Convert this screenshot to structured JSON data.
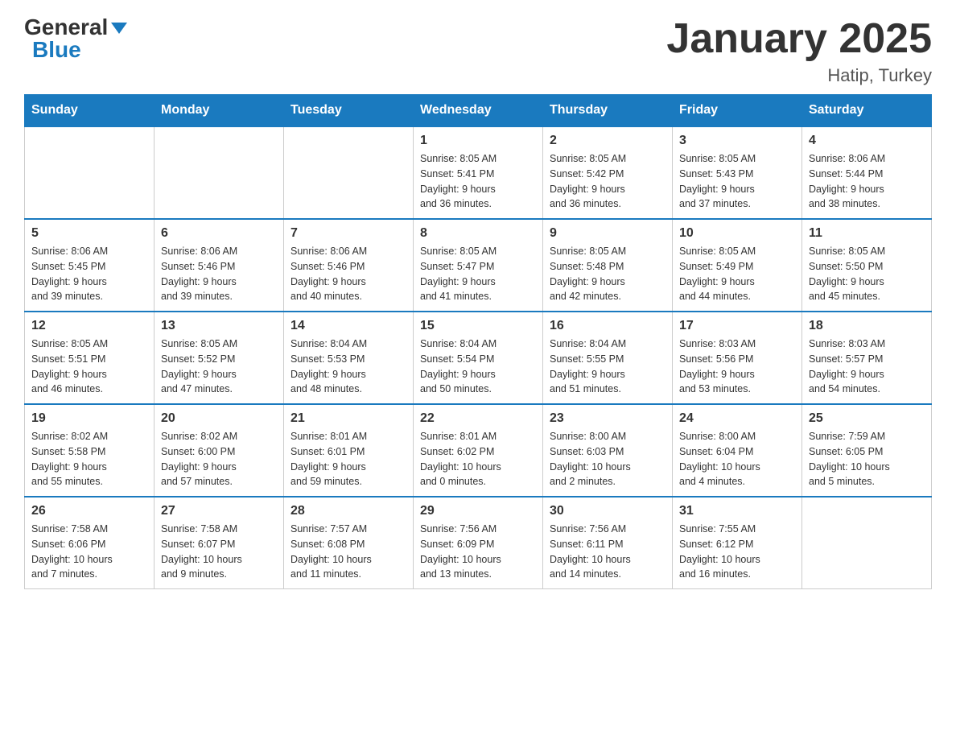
{
  "header": {
    "logo_general": "General",
    "logo_blue": "Blue",
    "month_title": "January 2025",
    "location": "Hatip, Turkey"
  },
  "weekdays": [
    "Sunday",
    "Monday",
    "Tuesday",
    "Wednesday",
    "Thursday",
    "Friday",
    "Saturday"
  ],
  "weeks": [
    [
      {
        "day": "",
        "info": ""
      },
      {
        "day": "",
        "info": ""
      },
      {
        "day": "",
        "info": ""
      },
      {
        "day": "1",
        "info": "Sunrise: 8:05 AM\nSunset: 5:41 PM\nDaylight: 9 hours\nand 36 minutes."
      },
      {
        "day": "2",
        "info": "Sunrise: 8:05 AM\nSunset: 5:42 PM\nDaylight: 9 hours\nand 36 minutes."
      },
      {
        "day": "3",
        "info": "Sunrise: 8:05 AM\nSunset: 5:43 PM\nDaylight: 9 hours\nand 37 minutes."
      },
      {
        "day": "4",
        "info": "Sunrise: 8:06 AM\nSunset: 5:44 PM\nDaylight: 9 hours\nand 38 minutes."
      }
    ],
    [
      {
        "day": "5",
        "info": "Sunrise: 8:06 AM\nSunset: 5:45 PM\nDaylight: 9 hours\nand 39 minutes."
      },
      {
        "day": "6",
        "info": "Sunrise: 8:06 AM\nSunset: 5:46 PM\nDaylight: 9 hours\nand 39 minutes."
      },
      {
        "day": "7",
        "info": "Sunrise: 8:06 AM\nSunset: 5:46 PM\nDaylight: 9 hours\nand 40 minutes."
      },
      {
        "day": "8",
        "info": "Sunrise: 8:05 AM\nSunset: 5:47 PM\nDaylight: 9 hours\nand 41 minutes."
      },
      {
        "day": "9",
        "info": "Sunrise: 8:05 AM\nSunset: 5:48 PM\nDaylight: 9 hours\nand 42 minutes."
      },
      {
        "day": "10",
        "info": "Sunrise: 8:05 AM\nSunset: 5:49 PM\nDaylight: 9 hours\nand 44 minutes."
      },
      {
        "day": "11",
        "info": "Sunrise: 8:05 AM\nSunset: 5:50 PM\nDaylight: 9 hours\nand 45 minutes."
      }
    ],
    [
      {
        "day": "12",
        "info": "Sunrise: 8:05 AM\nSunset: 5:51 PM\nDaylight: 9 hours\nand 46 minutes."
      },
      {
        "day": "13",
        "info": "Sunrise: 8:05 AM\nSunset: 5:52 PM\nDaylight: 9 hours\nand 47 minutes."
      },
      {
        "day": "14",
        "info": "Sunrise: 8:04 AM\nSunset: 5:53 PM\nDaylight: 9 hours\nand 48 minutes."
      },
      {
        "day": "15",
        "info": "Sunrise: 8:04 AM\nSunset: 5:54 PM\nDaylight: 9 hours\nand 50 minutes."
      },
      {
        "day": "16",
        "info": "Sunrise: 8:04 AM\nSunset: 5:55 PM\nDaylight: 9 hours\nand 51 minutes."
      },
      {
        "day": "17",
        "info": "Sunrise: 8:03 AM\nSunset: 5:56 PM\nDaylight: 9 hours\nand 53 minutes."
      },
      {
        "day": "18",
        "info": "Sunrise: 8:03 AM\nSunset: 5:57 PM\nDaylight: 9 hours\nand 54 minutes."
      }
    ],
    [
      {
        "day": "19",
        "info": "Sunrise: 8:02 AM\nSunset: 5:58 PM\nDaylight: 9 hours\nand 55 minutes."
      },
      {
        "day": "20",
        "info": "Sunrise: 8:02 AM\nSunset: 6:00 PM\nDaylight: 9 hours\nand 57 minutes."
      },
      {
        "day": "21",
        "info": "Sunrise: 8:01 AM\nSunset: 6:01 PM\nDaylight: 9 hours\nand 59 minutes."
      },
      {
        "day": "22",
        "info": "Sunrise: 8:01 AM\nSunset: 6:02 PM\nDaylight: 10 hours\nand 0 minutes."
      },
      {
        "day": "23",
        "info": "Sunrise: 8:00 AM\nSunset: 6:03 PM\nDaylight: 10 hours\nand 2 minutes."
      },
      {
        "day": "24",
        "info": "Sunrise: 8:00 AM\nSunset: 6:04 PM\nDaylight: 10 hours\nand 4 minutes."
      },
      {
        "day": "25",
        "info": "Sunrise: 7:59 AM\nSunset: 6:05 PM\nDaylight: 10 hours\nand 5 minutes."
      }
    ],
    [
      {
        "day": "26",
        "info": "Sunrise: 7:58 AM\nSunset: 6:06 PM\nDaylight: 10 hours\nand 7 minutes."
      },
      {
        "day": "27",
        "info": "Sunrise: 7:58 AM\nSunset: 6:07 PM\nDaylight: 10 hours\nand 9 minutes."
      },
      {
        "day": "28",
        "info": "Sunrise: 7:57 AM\nSunset: 6:08 PM\nDaylight: 10 hours\nand 11 minutes."
      },
      {
        "day": "29",
        "info": "Sunrise: 7:56 AM\nSunset: 6:09 PM\nDaylight: 10 hours\nand 13 minutes."
      },
      {
        "day": "30",
        "info": "Sunrise: 7:56 AM\nSunset: 6:11 PM\nDaylight: 10 hours\nand 14 minutes."
      },
      {
        "day": "31",
        "info": "Sunrise: 7:55 AM\nSunset: 6:12 PM\nDaylight: 10 hours\nand 16 minutes."
      },
      {
        "day": "",
        "info": ""
      }
    ]
  ]
}
